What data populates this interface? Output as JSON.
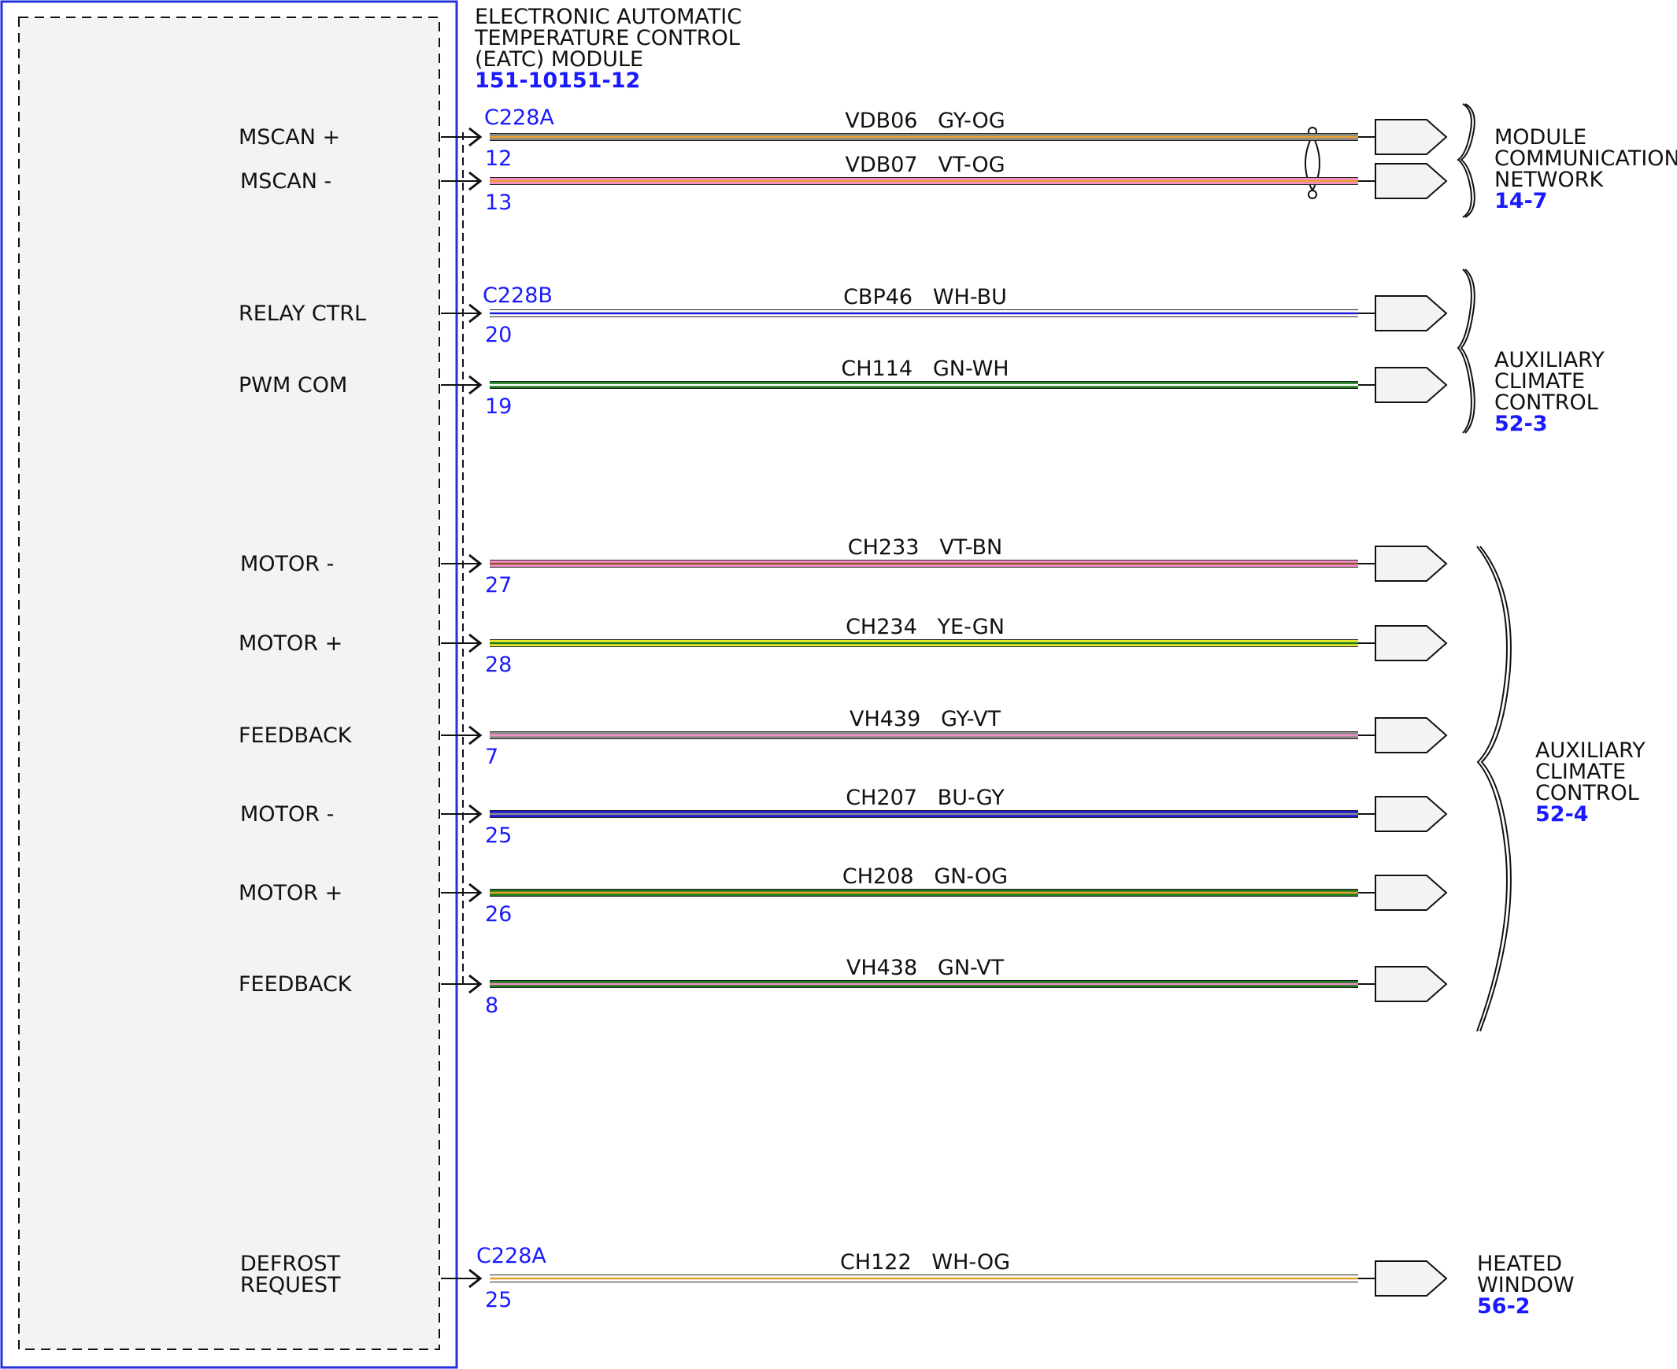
{
  "module": {
    "title_lines": [
      "ELECTRONIC AUTOMATIC",
      "TEMPERATURE CONTROL",
      "(EATC) MODULE"
    ],
    "ref": "151-10151-12"
  },
  "colors": {
    "GY": "#8a8a8a",
    "OG": "#e8a030",
    "VT": "#f58ec8",
    "WH": "#ffffff",
    "BU": "#1a1ad8",
    "GN": "#1e7a1e",
    "BN": "#8a5a2a",
    "YE": "#e8e830"
  },
  "connectors": [
    {
      "id": "c1",
      "label": "C228A"
    },
    {
      "id": "c2",
      "label": "C228B"
    },
    {
      "id": "c3",
      "label": "C228A"
    }
  ],
  "wires": [
    {
      "pin_label": "MSCAN +",
      "pin": "12",
      "circuit": "VDB06",
      "color_code": "GY-OG",
      "primary": "GY",
      "stripe": "OG"
    },
    {
      "pin_label": "MSCAN -",
      "pin": "13",
      "circuit": "VDB07",
      "color_code": "VT-OG",
      "primary": "VT",
      "stripe": "OG"
    },
    {
      "pin_label": "RELAY CTRL",
      "pin": "20",
      "circuit": "CBP46",
      "color_code": "WH-BU",
      "primary": "WH",
      "stripe": "BU"
    },
    {
      "pin_label": "PWM COM",
      "pin": "19",
      "circuit": "CH114",
      "color_code": "GN-WH",
      "primary": "GN",
      "stripe": "WH"
    },
    {
      "pin_label": "MOTOR -",
      "pin": "27",
      "circuit": "CH233",
      "color_code": "VT-BN",
      "primary": "VT",
      "stripe": "BN"
    },
    {
      "pin_label": "MOTOR +",
      "pin": "28",
      "circuit": "CH234",
      "color_code": "YE-GN",
      "primary": "YE",
      "stripe": "GN"
    },
    {
      "pin_label": "FEEDBACK",
      "pin": "7",
      "circuit": "VH439",
      "color_code": "GY-VT",
      "primary": "GY",
      "stripe": "VT"
    },
    {
      "pin_label": "MOTOR -",
      "pin": "25",
      "circuit": "CH207",
      "color_code": "BU-GY",
      "primary": "BU",
      "stripe": "GY"
    },
    {
      "pin_label": "MOTOR +",
      "pin": "26",
      "circuit": "CH208",
      "color_code": "GN-OG",
      "primary": "GN",
      "stripe": "OG"
    },
    {
      "pin_label": "FEEDBACK",
      "pin": "8",
      "circuit": "VH438",
      "color_code": "GN-VT",
      "primary": "GN",
      "stripe": "VT"
    },
    {
      "pin_label": "DEFROST REQUEST",
      "pin": "25",
      "circuit": "CH122",
      "color_code": "WH-OG",
      "primary": "WH",
      "stripe": "OG"
    }
  ],
  "destinations": [
    {
      "lines": [
        "MODULE",
        "COMMUNICATIONS",
        "NETWORK"
      ],
      "ref": "14-7"
    },
    {
      "lines": [
        "AUXILIARY",
        "CLIMATE",
        "CONTROL"
      ],
      "ref": "52-3"
    },
    {
      "lines": [
        "AUXILIARY",
        "CLIMATE",
        "CONTROL"
      ],
      "ref": "52-4"
    },
    {
      "lines": [
        "HEATED",
        "WINDOW"
      ],
      "ref": "56-2"
    }
  ]
}
